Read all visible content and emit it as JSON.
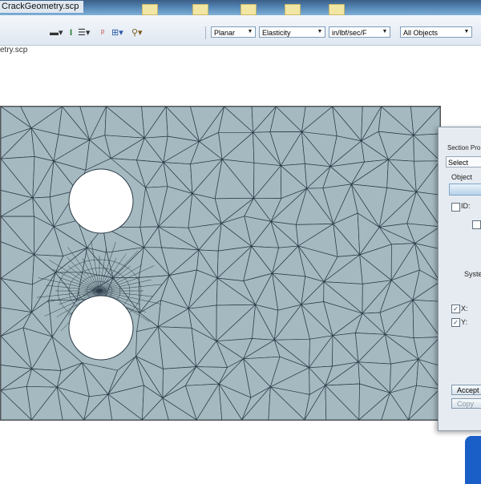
{
  "window": {
    "title": "CrackGeometry.scp",
    "doc_tab": "etry.scp"
  },
  "toolbar": {
    "combos": [
      {
        "key": "analysis_type",
        "value": "Planar"
      },
      {
        "key": "analysis_mode",
        "value": "Elasticity"
      },
      {
        "key": "units",
        "value": "in/lbf/sec/F"
      },
      {
        "key": "object_filter",
        "value": "All Objects"
      }
    ]
  },
  "dialog": {
    "title": "Section Pro",
    "select_label": "Select",
    "object_label": "Object",
    "id_label": "ID:",
    "system_label": "Syste",
    "x_label": "X:",
    "y_label": "Y:",
    "accept_label": "Accept",
    "copy_label": "Copy"
  },
  "colors": {
    "mesh_fill": "#a5b9c0",
    "mesh_line": "#2a3b47",
    "hole_fill": "#ffffff"
  }
}
